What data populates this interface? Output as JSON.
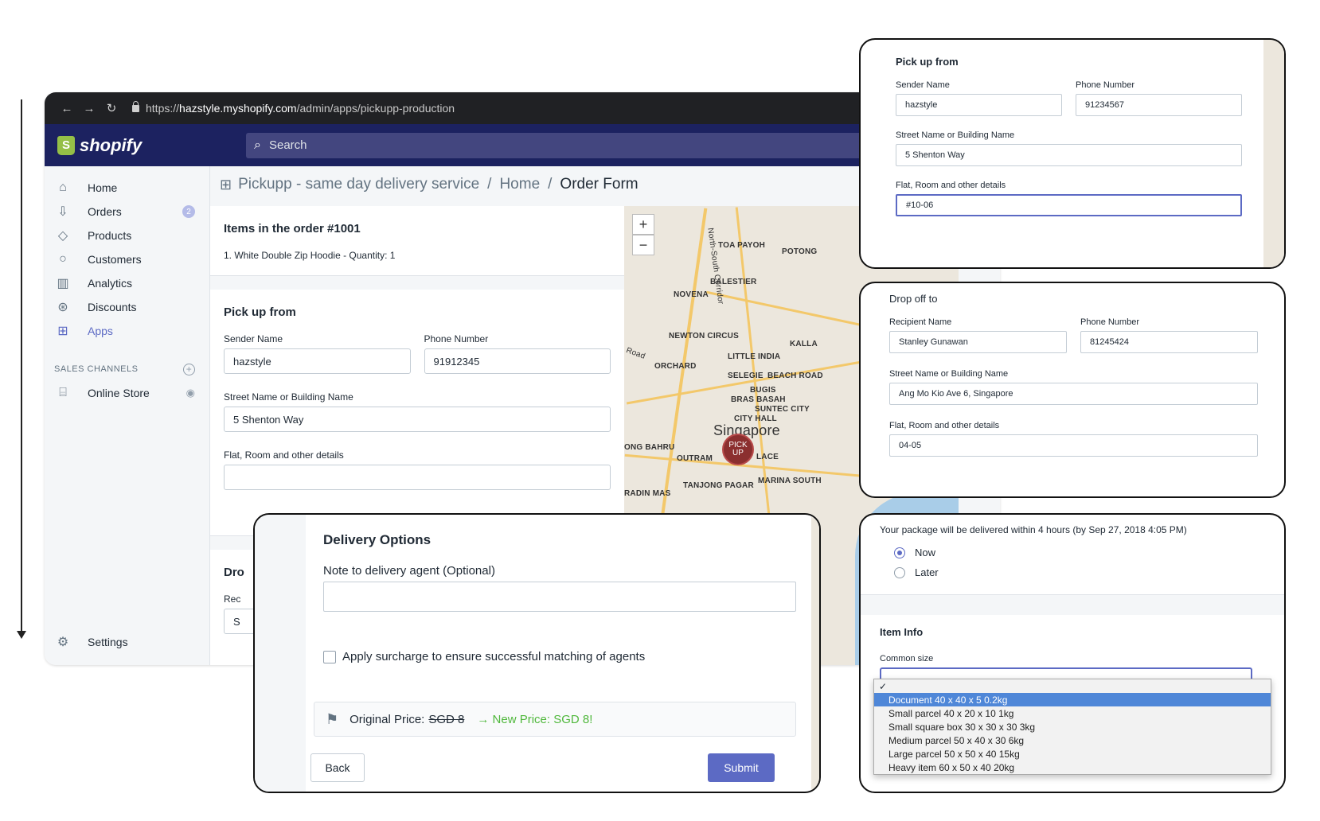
{
  "browser": {
    "url_prefix": "https://",
    "url_host": "hazstyle.myshopify.com",
    "url_path": "/admin/apps/pickupp-production"
  },
  "topbar": {
    "logo_text": "shopify",
    "search_placeholder": "Search"
  },
  "sidebar": {
    "items": [
      {
        "label": "Home",
        "icon": "home-icon"
      },
      {
        "label": "Orders",
        "icon": "orders-icon",
        "badge": "2"
      },
      {
        "label": "Products",
        "icon": "tag-icon"
      },
      {
        "label": "Customers",
        "icon": "person-icon"
      },
      {
        "label": "Analytics",
        "icon": "bar-chart-icon"
      },
      {
        "label": "Discounts",
        "icon": "discount-icon"
      },
      {
        "label": "Apps",
        "icon": "apps-icon"
      }
    ],
    "sales_channels_label": "SALES CHANNELS",
    "online_store": "Online Store",
    "settings": "Settings"
  },
  "breadcrumb": {
    "app": "Pickupp - same day delivery service",
    "sep": "/",
    "home": "Home",
    "current": "Order Form"
  },
  "order_items": {
    "title": "Items in the order #1001",
    "line": "1.  White Double Zip Hoodie - Quantity: 1"
  },
  "pickup": {
    "title": "Pick up from",
    "sender_label": "Sender Name",
    "sender_value": "hazstyle",
    "phone_label": "Phone Number",
    "phone_value": "91912345",
    "street_label": "Street Name or Building Name",
    "street_value": "5 Shenton Way",
    "flat_label": "Flat, Room and other details"
  },
  "drop_partial": {
    "title": "Dro",
    "label": "Rec",
    "value": "S"
  },
  "map": {
    "zoom_in": "+",
    "zoom_out": "−",
    "labels": [
      "TOA PAYOH",
      "POTONG",
      "BALESTIER",
      "NOVENA",
      "NEWTON CIRCUS",
      "KALLA",
      "LITTLE INDIA",
      "ORCHARD",
      "SELEGIE",
      "BEACH ROAD",
      "BUGIS",
      "BRAS BASAH",
      "SUNTEC CITY",
      "CITY HALL",
      "Singapore",
      "ONG BAHRU",
      "OUTRAM",
      "LACE",
      "TANJONG PAGAR",
      "MARINA SOUTH",
      "RADIN MAS",
      "North-South Corridor",
      "Road"
    ],
    "pin": "PICK UP"
  },
  "panel_pickup": {
    "title": "Pick up from",
    "sender_label": "Sender Name",
    "sender_value": "hazstyle",
    "phone_label": "Phone Number",
    "phone_value": "91234567",
    "street_label": "Street Name or Building Name",
    "street_value": "5 Shenton Way",
    "flat_label": "Flat, Room and other details",
    "flat_value": "#10-06"
  },
  "panel_drop": {
    "title": "Drop off to",
    "recipient_label": "Recipient Name",
    "recipient_value": "Stanley Gunawan",
    "phone_label": "Phone Number",
    "phone_value": "81245424",
    "street_label": "Street Name or Building Name",
    "street_value": "Ang Mo Kio Ave 6, Singapore",
    "flat_label": "Flat, Room and other details",
    "flat_value": "04-05"
  },
  "panel_time": {
    "notice": "Your package will be delivered within 4 hours (by Sep 27, 2018 4:05 PM)",
    "now": "Now",
    "later": "Later",
    "item_info": "Item Info",
    "common_size": "Common size",
    "check": "✓",
    "options": [
      "Document 40 x 40 x 5 0.2kg",
      "Small parcel 40 x 20 x 10 1kg",
      "Small square box 30 x 30 x 30 3kg",
      "Medium parcel 50 x 40 x 30 6kg",
      "Large parcel 50 x 50 x 40 15kg",
      "Heavy item 60 x 50 x 40 20kg"
    ]
  },
  "panel_delivery": {
    "title": "Delivery Options",
    "note_label": "Note to delivery agent (Optional)",
    "surcharge": "Apply surcharge to ensure successful matching of agents",
    "original_price_label": "Original Price:",
    "original_price": "SGD 8",
    "new_price": "→ New Price: SGD 8!",
    "back": "Back",
    "submit": "Submit"
  },
  "colors": {
    "brand_nav": "#1c2260",
    "accent": "#5c6ac4",
    "green": "#50b83c"
  }
}
